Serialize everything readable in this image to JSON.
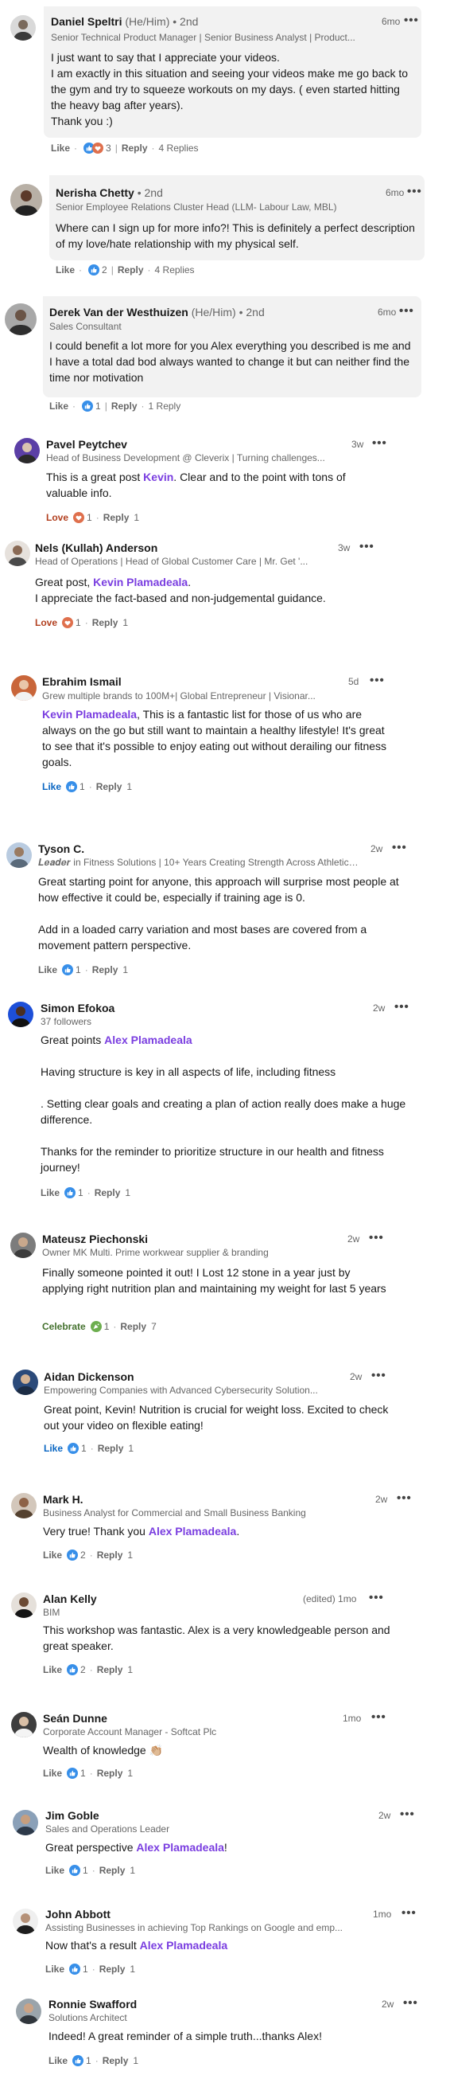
{
  "colors": {
    "accent": "#0a66c2",
    "mention": "#7a3ee0",
    "bubble": "#f2f2f2",
    "love": "#df704d",
    "celebrate": "#6dae4f"
  },
  "comments": [
    {
      "name": "Daniel Speltri",
      "pronouns": "(He/Him)",
      "degree": "• 2nd",
      "headline": "Senior Technical Product Manager | Senior Business Analyst | Product...",
      "time": "6mo",
      "body": [
        "I just want to say that I appreciate your videos.",
        "I am exactly in this situation and seeing your videos make me go back to the gym and try to squeeze workouts on my days. ( even started hitting the heavy bag after years).",
        "Thank you :)"
      ],
      "like_label": "Like",
      "reaction_icons": [
        "like-icon",
        "love-icon"
      ],
      "reaction_count": "3",
      "reply_label": "Reply",
      "replies": "4 Replies"
    },
    {
      "name": "Nerisha Chetty",
      "pronouns": "",
      "degree": "• 2nd",
      "headline": "Senior Employee Relations Cluster Head (LLM- Labour Law, MBL)",
      "time": "6mo",
      "body": [
        "Where can I sign up for more info?! This is definitely a perfect description of my love/hate relationship with my physical self."
      ],
      "like_label": "Like",
      "reaction_icons": [
        "like-icon"
      ],
      "reaction_count": "2",
      "reply_label": "Reply",
      "replies": "4 Replies"
    },
    {
      "name": "Derek Van der Westhuizen",
      "pronouns": "(He/Him)",
      "degree": "• 2nd",
      "headline": "Sales Consultant",
      "time": "6mo",
      "body": [
        "I could benefit a lot more for you Alex everything you described is me and I have a total dad bod always wanted to change it but can neither find the time nor motivation"
      ],
      "like_label": "Like",
      "reaction_icons": [
        "like-icon"
      ],
      "reaction_count": "1",
      "reply_label": "Reply",
      "replies": "1 Reply"
    },
    {
      "name": "Pavel Peytchev",
      "headline": "Head of Business Development @ Cleverix | Turning challenges...",
      "time": "3w",
      "body_pre": "This is a great post ",
      "mention": "Kevin",
      "body_post": ". Clear and to the point with tons of valuable info.",
      "like_label": "Love",
      "reaction_icons": [
        "love-icon"
      ],
      "reaction_count": "1",
      "reply_label": "Reply",
      "replies": "1"
    },
    {
      "name": "Nels (Kullah) Anderson",
      "headline": "Head of Operations | Head of Global Customer Care | Mr. Get '...",
      "time": "3w",
      "body_pre": "Great post, ",
      "mention": "Kevin Plamadeala",
      "body_post": ".",
      "body_extra": [
        "I appreciate the fact-based and non-judgemental guidance."
      ],
      "like_label": "Love",
      "reaction_icons": [
        "love-icon"
      ],
      "reaction_count": "1",
      "reply_label": "Reply",
      "replies": "1"
    },
    {
      "name": "Ebrahim Ismail",
      "headline": "Grew multiple brands to 100M+| Global Entrepreneur | Visionar...",
      "time": "5d",
      "mention": "Kevin Plamadeala",
      "body_post": ", This is a fantastic list for those of us who are always on the go but still want to maintain a healthy lifestyle! It's great to see that it's possible to enjoy eating out without derailing our fitness goals.",
      "like_label": "Like",
      "reaction_icons": [
        "like-icon"
      ],
      "reaction_count": "1",
      "reply_label": "Reply",
      "replies": "1"
    },
    {
      "name": "Tyson C.",
      "headline": "𝑳𝒆𝒂𝒅𝒆𝒓 in Fitness Solutions | 10+ Years Creating Strength Across Athletics...",
      "time": "2w",
      "body": [
        "Great starting point for anyone, this approach will surprise most people at how effective it could be, especially if training age is 0.",
        "",
        "Add in a loaded carry variation and most bases are covered from a movement pattern perspective."
      ],
      "like_label": "Like",
      "reaction_icons": [
        "like-icon"
      ],
      "reaction_count": "1",
      "reply_label": "Reply",
      "replies": "1"
    },
    {
      "name": "Simon Efokoa",
      "headline": "37 followers",
      "time": "2w",
      "body_pre": "Great points ",
      "mention": "Alex Plamadeala",
      "body_post": "",
      "body_extra": [
        "",
        "Having structure is key in all aspects of life, including fitness",
        "",
        ". Setting clear goals and creating a plan of action really does make a huge difference.",
        "",
        "Thanks for the reminder to prioritize structure in our health and fitness journey!"
      ],
      "like_label": "Like",
      "reaction_icons": [
        "like-icon"
      ],
      "reaction_count": "1",
      "reply_label": "Reply",
      "replies": "1"
    },
    {
      "name": "Mateusz Piechonski",
      "headline": "Owner MK Multi. Prime workwear supplier & branding",
      "time": "2w",
      "body": [
        "Finally someone pointed it out! I Lost 12 stone in a year just by applying right nutrition plan and maintaining my weight for last 5 years"
      ],
      "like_label": "Celebrate",
      "reaction_icons": [
        "celebrate-icon"
      ],
      "reaction_count": "1",
      "reply_label": "Reply",
      "replies": "7"
    },
    {
      "name": "Aidan Dickenson",
      "headline": "Empowering Companies with Advanced Cybersecurity Solution...",
      "time": "2w",
      "body": [
        "Great point, Kevin! Nutrition is crucial for weight loss. Excited to check out your video on flexible eating!"
      ],
      "like_label": "Like",
      "reaction_icons": [
        "like-icon"
      ],
      "reaction_count": "1",
      "reply_label": "Reply",
      "replies": "1"
    },
    {
      "name": "Mark H.",
      "headline": "Business Analyst for Commercial and Small Business Banking",
      "time": "2w",
      "body_pre": "Very true! Thank you ",
      "mention": "Alex Plamadeala",
      "body_post": ".",
      "like_label": "Like",
      "reaction_icons": [
        "like-icon"
      ],
      "reaction_count": "2",
      "reply_label": "Reply",
      "replies": "1"
    },
    {
      "name": "Alan Kelly",
      "headline": "BIM",
      "time": "(edited) 1mo",
      "body": [
        "This workshop was fantastic. Alex is a very knowledgeable person and great speaker."
      ],
      "like_label": "Like",
      "reaction_icons": [
        "like-icon"
      ],
      "reaction_count": "2",
      "reply_label": "Reply",
      "replies": "1"
    },
    {
      "name": "Seán Dunne",
      "headline": "Corporate Account Manager - Softcat Plc",
      "time": "1mo",
      "body": [
        "Wealth of knowledge 👏🏼"
      ],
      "like_label": "Like",
      "reaction_icons": [
        "like-icon"
      ],
      "reaction_count": "1",
      "reply_label": "Reply",
      "replies": "1"
    },
    {
      "name": "Jim Goble",
      "headline": "Sales and Operations Leader",
      "time": "2w",
      "body_pre": "Great perspective ",
      "mention": "Alex Plamadeala",
      "body_post": "!",
      "like_label": "Like",
      "reaction_icons": [
        "like-icon"
      ],
      "reaction_count": "1",
      "reply_label": "Reply",
      "replies": "1"
    },
    {
      "name": "John Abbott",
      "headline": "Assisting Businesses in achieving Top Rankings on Google and emp...",
      "time": "1mo",
      "body_pre": "Now that's a result ",
      "mention": "Alex Plamadeala",
      "body_post": "",
      "like_label": "Like",
      "reaction_icons": [
        "like-icon"
      ],
      "reaction_count": "1",
      "reply_label": "Reply",
      "replies": "1"
    },
    {
      "name": "Ronnie Swafford",
      "headline": "Solutions Architect",
      "time": "2w",
      "body": [
        "Indeed! A great reminder of a simple truth...thanks Alex!"
      ],
      "like_label": "Like",
      "reaction_icons": [
        "like-icon"
      ],
      "reaction_count": "1",
      "reply_label": "Reply",
      "replies": "1"
    }
  ]
}
